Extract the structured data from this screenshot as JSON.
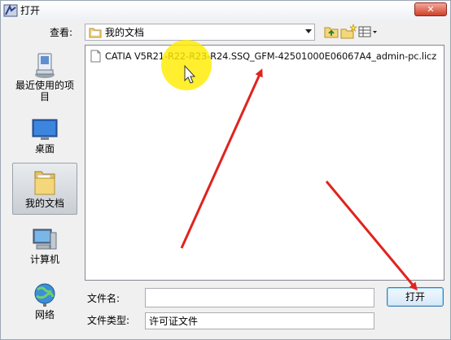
{
  "window": {
    "title": "打开",
    "close_glyph": "✕"
  },
  "lookin": {
    "label": "查看:",
    "value": "我的文档"
  },
  "places": [
    {
      "label": "最近使用的项目",
      "icon": "recent-items-icon"
    },
    {
      "label": "桌面",
      "icon": "desktop-icon"
    },
    {
      "label": "我的文档",
      "icon": "my-documents-icon",
      "selected": true
    },
    {
      "label": "计算机",
      "icon": "computer-icon"
    },
    {
      "label": "网络",
      "icon": "network-icon"
    }
  ],
  "files": [
    {
      "name": "CATIA V5R21-R22-R23-R24.SSQ_GFM-42501000E06067A4_admin-pc.licz",
      "icon": "document-icon"
    }
  ],
  "filename": {
    "label": "文件名:",
    "value": ""
  },
  "filetype": {
    "label": "文件类型:",
    "value": "许可证文件"
  },
  "buttons": {
    "open": "打开"
  },
  "annotation": {
    "arrow_color": "#e0231f",
    "highlight_color": "#ffec00"
  }
}
